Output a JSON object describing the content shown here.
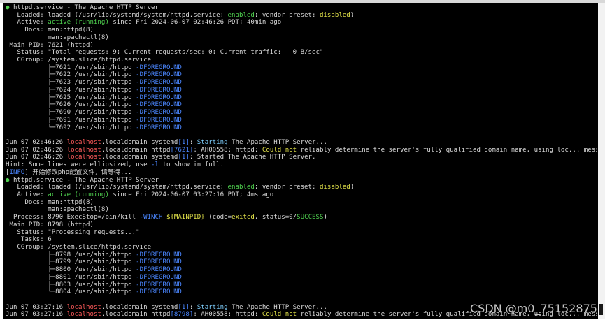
{
  "colors": {
    "terminal_bg": "#000000",
    "default_text": "#d9d9d9",
    "green": "#4fd14f",
    "yellow": "#e5e54a",
    "blue": "#4a86ff",
    "red": "#ff5a5a",
    "cyan": "#7fd0ff"
  },
  "terminal": {
    "lines": [
      [
        [
          "dot",
          "● "
        ],
        [
          "",
          "httpd.service - The Apache HTTP Server"
        ]
      ],
      [
        [
          "",
          "   Loaded: loaded (/usr/lib/systemd/system/httpd.service; "
        ],
        [
          "green",
          "enabled"
        ],
        [
          "",
          "; vendor preset: "
        ],
        [
          "yellow",
          "disabled"
        ],
        [
          "",
          ")"
        ]
      ],
      [
        [
          "",
          "   Active: "
        ],
        [
          "green",
          "active (running)"
        ],
        [
          "",
          " since Fri 2024-06-07 02:46:26 PDT; 40min ago"
        ]
      ],
      [
        [
          "",
          "     Docs: man:httpd(8)"
        ]
      ],
      [
        [
          "",
          "           man:apachectl(8)"
        ]
      ],
      [
        [
          "",
          " Main PID: 7621 (httpd)"
        ]
      ],
      [
        [
          "",
          "   Status: \"Total requests: 9; Current requests/sec: 0; Current traffic:   0 B/sec\""
        ]
      ],
      [
        [
          "",
          "   CGroup: /system.slice/httpd.service"
        ]
      ],
      [
        [
          "",
          "           ├─7621 /usr/sbin/httpd "
        ],
        [
          "blue",
          "-DFOREGROUND"
        ]
      ],
      [
        [
          "",
          "           ├─7622 /usr/sbin/httpd "
        ],
        [
          "blue",
          "-DFOREGROUND"
        ]
      ],
      [
        [
          "",
          "           ├─7623 /usr/sbin/httpd "
        ],
        [
          "blue",
          "-DFOREGROUND"
        ]
      ],
      [
        [
          "",
          "           ├─7624 /usr/sbin/httpd "
        ],
        [
          "blue",
          "-DFOREGROUND"
        ]
      ],
      [
        [
          "",
          "           ├─7625 /usr/sbin/httpd "
        ],
        [
          "blue",
          "-DFOREGROUND"
        ]
      ],
      [
        [
          "",
          "           ├─7626 /usr/sbin/httpd "
        ],
        [
          "blue",
          "-DFOREGROUND"
        ]
      ],
      [
        [
          "",
          "           ├─7690 /usr/sbin/httpd "
        ],
        [
          "blue",
          "-DFOREGROUND"
        ]
      ],
      [
        [
          "",
          "           ├─7691 /usr/sbin/httpd "
        ],
        [
          "blue",
          "-DFOREGROUND"
        ]
      ],
      [
        [
          "",
          "           └─7692 /usr/sbin/httpd "
        ],
        [
          "blue",
          "-DFOREGROUND"
        ]
      ],
      [
        [
          "",
          ""
        ]
      ],
      [
        [
          "",
          "Jun 07 02:46:26 "
        ],
        [
          "red",
          "localhost"
        ],
        [
          "",
          ".localdomain systemd"
        ],
        [
          "blue",
          "[1]"
        ],
        [
          "",
          ": "
        ],
        [
          "cyan",
          "Starting"
        ],
        [
          "",
          " The Apache HTTP Server..."
        ]
      ],
      [
        [
          "",
          "Jun 07 02:46:26 "
        ],
        [
          "red",
          "localhost"
        ],
        [
          "",
          ".localdomain httpd"
        ],
        [
          "blue",
          "[7621]"
        ],
        [
          "",
          ": AH00558: httpd: "
        ],
        [
          "yellow",
          "Could not"
        ],
        [
          "",
          " reliably determine the server's fully qualified domain name, using loc... message"
        ]
      ],
      [
        [
          "",
          "Jun 07 02:46:26 "
        ],
        [
          "red",
          "localhost"
        ],
        [
          "",
          ".localdomain systemd"
        ],
        [
          "blue",
          "[1]"
        ],
        [
          "",
          ": Started The Apache HTTP Server."
        ]
      ],
      [
        [
          "",
          "Hint: Some lines were ellipsized, use "
        ],
        [
          "blue",
          "-l"
        ],
        [
          "",
          " to show in full."
        ]
      ],
      [
        [
          "",
          "["
        ],
        [
          "blue",
          "INFO"
        ],
        [
          "",
          "] 开始修改php配置文件，请等待..."
        ]
      ],
      [
        [
          "dot",
          "● "
        ],
        [
          "",
          "httpd.service - The Apache HTTP Server"
        ]
      ],
      [
        [
          "",
          "   Loaded: loaded (/usr/lib/systemd/system/httpd.service; "
        ],
        [
          "green",
          "enabled"
        ],
        [
          "",
          "; vendor preset: "
        ],
        [
          "yellow",
          "disabled"
        ],
        [
          "",
          ")"
        ]
      ],
      [
        [
          "",
          "   Active: "
        ],
        [
          "green",
          "active (running)"
        ],
        [
          "",
          " since Fri 2024-06-07 03:27:16 PDT; 4ms ago"
        ]
      ],
      [
        [
          "",
          "     Docs: man:httpd(8)"
        ]
      ],
      [
        [
          "",
          "           man:apachectl(8)"
        ]
      ],
      [
        [
          "",
          "  Process: 8790 ExecStop=/bin/kill "
        ],
        [
          "blue",
          "-WINCH"
        ],
        [
          "yellow",
          " ${MAINPID}"
        ],
        [
          "",
          " (code="
        ],
        [
          "yellow",
          "exited"
        ],
        [
          "",
          ", status=0/"
        ],
        [
          "green",
          "SUCCESS"
        ],
        [
          "",
          ")"
        ]
      ],
      [
        [
          "",
          " Main PID: 8798 (httpd)"
        ]
      ],
      [
        [
          "",
          "   Status: \"Processing requests...\""
        ]
      ],
      [
        [
          "",
          "    Tasks: 6"
        ]
      ],
      [
        [
          "",
          "   CGroup: /system.slice/httpd.service"
        ]
      ],
      [
        [
          "",
          "           ├─8798 /usr/sbin/httpd "
        ],
        [
          "blue",
          "-DFOREGROUND"
        ]
      ],
      [
        [
          "",
          "           ├─8799 /usr/sbin/httpd "
        ],
        [
          "blue",
          "-DFOREGROUND"
        ]
      ],
      [
        [
          "",
          "           ├─8800 /usr/sbin/httpd "
        ],
        [
          "blue",
          "-DFOREGROUND"
        ]
      ],
      [
        [
          "",
          "           ├─8801 /usr/sbin/httpd "
        ],
        [
          "blue",
          "-DFOREGROUND"
        ]
      ],
      [
        [
          "",
          "           ├─8803 /usr/sbin/httpd "
        ],
        [
          "blue",
          "-DFOREGROUND"
        ]
      ],
      [
        [
          "",
          "           └─8804 /usr/sbin/httpd "
        ],
        [
          "blue",
          "-DFOREGROUND"
        ]
      ],
      [
        [
          "",
          ""
        ]
      ],
      [
        [
          "",
          "Jun 07 03:27:16 "
        ],
        [
          "red",
          "localhost"
        ],
        [
          "",
          ".localdomain systemd"
        ],
        [
          "blue",
          "[1]"
        ],
        [
          "",
          ": "
        ],
        [
          "cyan",
          "Starting"
        ],
        [
          "",
          " The Apache HTTP Server..."
        ]
      ],
      [
        [
          "",
          "Jun 07 03:27:16 "
        ],
        [
          "red",
          "localhost"
        ],
        [
          "",
          ".localdomain httpd"
        ],
        [
          "blue",
          "[8798]"
        ],
        [
          "",
          ": AH00558: httpd: "
        ],
        [
          "yellow",
          "Could not"
        ],
        [
          "",
          " reliably determine the server's fully qualified domain name, using loc... message"
        ]
      ]
    ]
  },
  "watermark": {
    "text": "CSDN @m0_75152875"
  }
}
